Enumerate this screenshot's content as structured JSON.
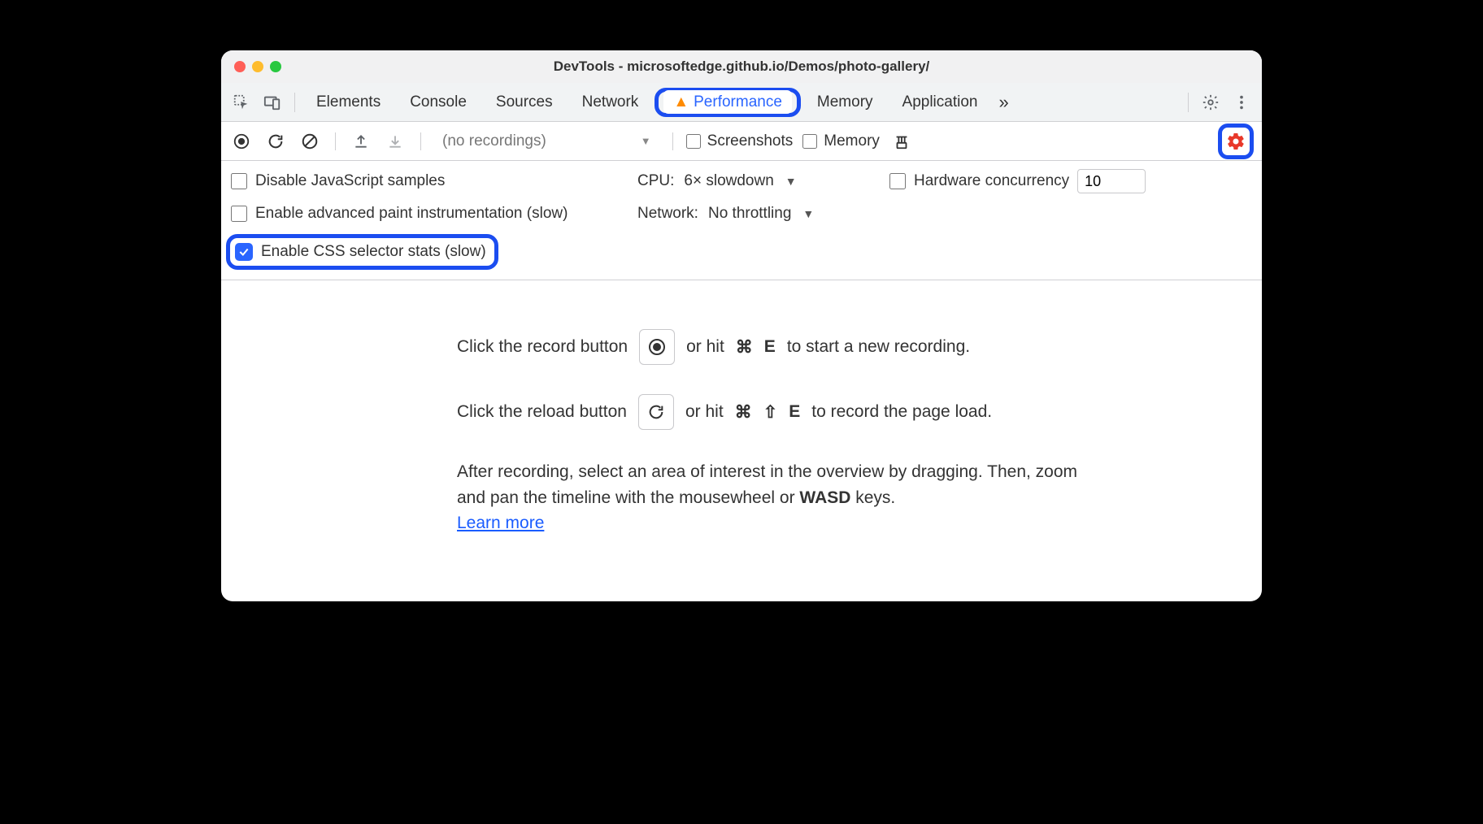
{
  "titlebar": {
    "title": "DevTools - microsoftedge.github.io/Demos/photo-gallery/"
  },
  "tabs": {
    "items": [
      "Elements",
      "Console",
      "Sources",
      "Network",
      "Performance",
      "Memory",
      "Application"
    ],
    "active": "Performance",
    "overflow_glyph": "»"
  },
  "toolbar": {
    "recordings_placeholder": "(no recordings)",
    "screenshots_label": "Screenshots",
    "memory_label": "Memory"
  },
  "opts": {
    "disable_js": "Disable JavaScript samples",
    "cpu_label": "CPU:",
    "cpu_value": "6× slowdown",
    "hw_label": "Hardware concurrency",
    "hw_value": "10",
    "adv_paint": "Enable advanced paint instrumentation (slow)",
    "net_label": "Network:",
    "net_value": "No throttling",
    "css_stats": "Enable CSS selector stats (slow)"
  },
  "main": {
    "line1_a": "Click the record button",
    "line1_b": "or hit",
    "line1_key1": "⌘",
    "line1_key2": "E",
    "line1_c": "to start a new recording.",
    "line2_a": "Click the reload button",
    "line2_b": "or hit",
    "line2_key1": "⌘",
    "line2_key2": "⇧",
    "line2_key3": "E",
    "line2_c": "to record the page load.",
    "para": "After recording, select an area of interest in the overview by dragging. Then, zoom and pan the timeline with the mousewheel or ",
    "para_bold": "WASD",
    "para_tail": " keys.",
    "learn_more": "Learn more"
  }
}
